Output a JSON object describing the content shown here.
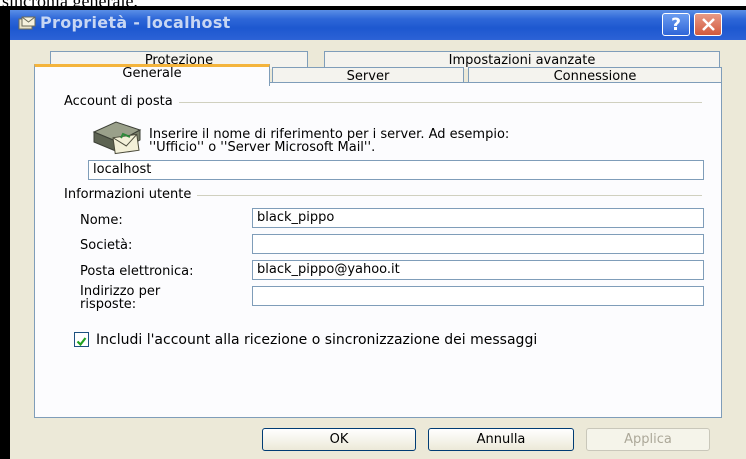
{
  "caption_above": "sincronia generale.",
  "window": {
    "title": "Proprietà - localhost"
  },
  "tabs": {
    "row1": [
      {
        "label": "Protezione"
      },
      {
        "label": "Impostazioni avanzate"
      }
    ],
    "row2": [
      {
        "label": "Generale",
        "active": true
      },
      {
        "label": "Server"
      },
      {
        "label": "Connessione"
      }
    ]
  },
  "mail_account": {
    "group_label": "Account di posta",
    "icon": "mail-account-icon",
    "description_line1": "Inserire il nome di riferimento per i server. Ad esempio:",
    "description_line2": "''Ufficio'' o ''Server Microsoft Mail''.",
    "name_value": "localhost"
  },
  "user_info": {
    "group_label": "Informazioni utente",
    "fields": [
      {
        "label": "Nome:",
        "value": "black_pippo"
      },
      {
        "label": "Società:",
        "value": ""
      },
      {
        "label": "Posta elettronica:",
        "value": "black_pippo@yahoo.it"
      },
      {
        "label_line1": "Indirizzo per",
        "label_line2": "risposte:",
        "value": ""
      }
    ]
  },
  "include_checkbox": {
    "label": "Includi l'account alla ricezione o sincronizzazione dei messaggi",
    "checked": true
  },
  "buttons": {
    "ok": "OK",
    "cancel": "Annulla",
    "apply": "Applica"
  },
  "colors": {
    "titlebar": "#1d58d0",
    "dialog_bg": "#ece9d8",
    "active_tab_accent": "#f4b43c",
    "close_button": "#d25a3e"
  }
}
